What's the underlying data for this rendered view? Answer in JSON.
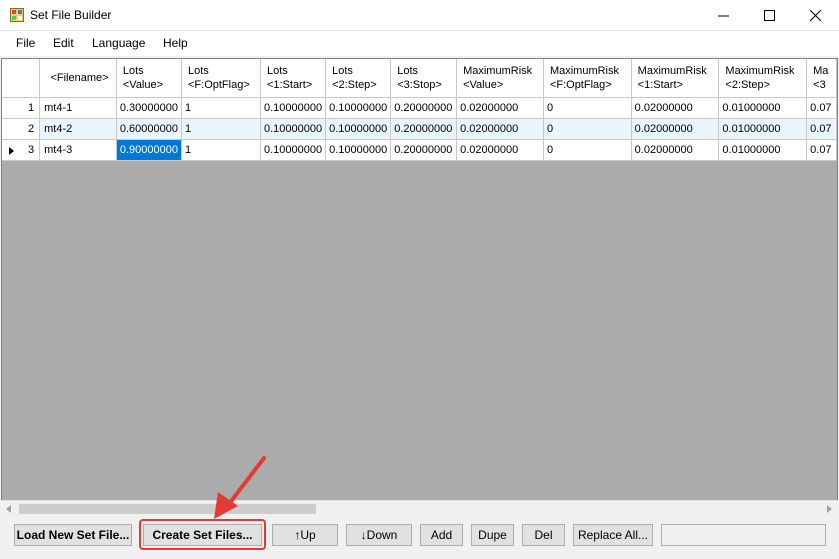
{
  "window": {
    "title": "Set File Builder"
  },
  "menu": {
    "items": [
      {
        "label": "File"
      },
      {
        "label": "Edit"
      },
      {
        "label": "Language"
      },
      {
        "label": "Help"
      }
    ]
  },
  "grid": {
    "columns": [
      {
        "line1": "<Filename>",
        "line2": ""
      },
      {
        "line1": "Lots",
        "line2": "<Value>"
      },
      {
        "line1": "Lots",
        "line2": "<F:OptFlag>"
      },
      {
        "line1": "Lots",
        "line2": "<1:Start>"
      },
      {
        "line1": "Lots",
        "line2": "<2:Step>"
      },
      {
        "line1": "Lots",
        "line2": "<3:Stop>"
      },
      {
        "line1": "MaximumRisk",
        "line2": "<Value>"
      },
      {
        "line1": "MaximumRisk",
        "line2": "<F:OptFlag>"
      },
      {
        "line1": "MaximumRisk",
        "line2": "<1:Start>"
      },
      {
        "line1": "MaximumRisk",
        "line2": "<2:Step>"
      },
      {
        "line1": "Ma",
        "line2": "<3"
      }
    ],
    "rows": [
      {
        "num": "1",
        "current": false,
        "cells": [
          "mt4-1",
          "0.30000000",
          "1",
          "0.10000000",
          "0.10000000",
          "0.20000000",
          "0.02000000",
          "0",
          "0.02000000",
          "0.01000000",
          "0.07"
        ]
      },
      {
        "num": "2",
        "current": false,
        "cells": [
          "mt4-2",
          "0.60000000",
          "1",
          "0.10000000",
          "0.10000000",
          "0.20000000",
          "0.02000000",
          "0",
          "0.02000000",
          "0.01000000",
          "0.07"
        ]
      },
      {
        "num": "3",
        "current": true,
        "cells": [
          "mt4-3",
          "0.90000000",
          "1",
          "0.10000000",
          "0.10000000",
          "0.20000000",
          "0.02000000",
          "0",
          "0.02000000",
          "0.01000000",
          "0.07"
        ]
      }
    ],
    "selected_cell": {
      "row": 3,
      "column": "Lots <Value>",
      "value": "0.90000000"
    }
  },
  "buttons": {
    "load": "Load New Set File...",
    "create": "Create Set Files...",
    "up": "↑Up",
    "down": "↓Down",
    "add": "Add",
    "dupe": "Dupe",
    "del": "Del",
    "replace_all": "Replace All..."
  },
  "colors": {
    "selection": "#0078d7",
    "alt_row": "#eaf4fb",
    "grid_background": "#ababab",
    "annotation": "#e53935"
  }
}
